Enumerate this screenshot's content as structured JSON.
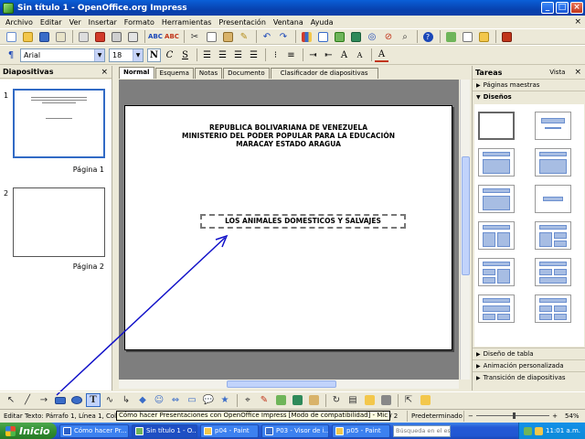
{
  "window": {
    "title": "Sin título 1 - OpenOffice.org Impress"
  },
  "menu": [
    "Archivo",
    "Editar",
    "Ver",
    "Insertar",
    "Formato",
    "Herramientas",
    "Presentación",
    "Ventana",
    "Ayuda"
  ],
  "format": {
    "font": "Arial",
    "size": "18"
  },
  "slides_panel": {
    "title": "Diapositivas",
    "slides": [
      {
        "number": "1",
        "label": "Página 1"
      },
      {
        "number": "2",
        "label": "Página 2"
      }
    ]
  },
  "view_tabs": [
    "Normal",
    "Esquema",
    "Notas",
    "Documento",
    "Clasificador de diapositivas"
  ],
  "slide": {
    "heading_lines": [
      "REPUBLICA BOLIVARIANA DE VENEZUELA",
      "MINISTERIO DEL PODER POPULAR PARA LA EDUCACIÓN",
      "MARACAY ESTADO ARAGUA"
    ],
    "textbox": "LOS ANIMALES DOMESTICOS Y SALVAJES"
  },
  "tasks_panel": {
    "title": "Tareas",
    "view_label": "Vista",
    "sections_top": [
      "Páginas maestras",
      "Diseños"
    ],
    "sections_bottom": [
      "Diseño de tabla",
      "Animación personalizada",
      "Transición de diapositivas"
    ]
  },
  "status": {
    "edit_text": "Editar Texto: Párrafo 1, Línea 1, Columna",
    "tooltip": "Cómo hacer Presentaciones con OpenOffice Impress [Modo de compatibilidad] - Mic",
    "page": "Página 1 / 2",
    "style": "Predeterminado",
    "zoom": "54%"
  },
  "taskbar": {
    "start_label": "Inicio",
    "tasks": [
      "Cómo hacer Pr...",
      "Sin título 1 - O...",
      "p04 - Paint",
      "P03 - Visor de i...",
      "p05 - Paint"
    ],
    "search_placeholder": "Búsqueda en el escri",
    "clock": "11:01 a.m."
  }
}
